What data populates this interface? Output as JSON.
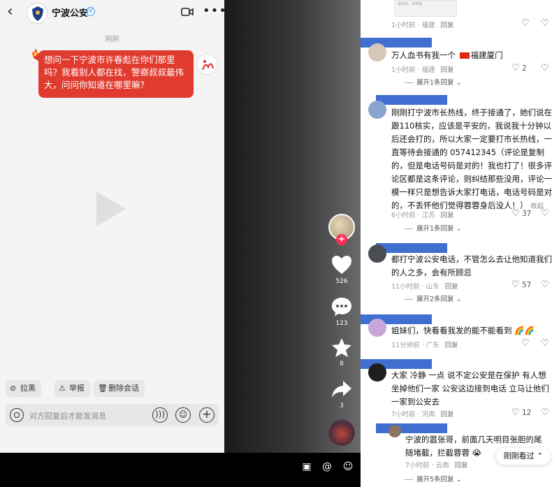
{
  "chat": {
    "contact_name": "宁波公安",
    "verified_badge": "V",
    "timestamp": "刚刚",
    "message": "想问一下宁波市许春彪在你们那里吗？我看别人都在找，警察叔叔最伟大，问问你知道在哪里嘛？",
    "actions": {
      "block": "拉黑",
      "report": "举报",
      "delete": "删除会话"
    },
    "input_placeholder": "对方回复后才能发消息",
    "icons": [
      "back-icon",
      "video-call-icon",
      "more-icon",
      "camera-icon",
      "voice-icon",
      "emoji-icon",
      "plus-icon"
    ]
  },
  "video_rail": {
    "likes": "526",
    "comments": "123",
    "favorites": "8",
    "shares": "3",
    "follow_plus": "+"
  },
  "bottom_bar": {
    "icons": [
      "image-icon",
      "mention-icon",
      "emoji-icon"
    ]
  },
  "comments": [
    {
      "meta_time": "1小时前",
      "meta_location": "福建",
      "reply": "回复",
      "thumb_text": "进去的，你找我"
    },
    {
      "text": "万人血书有我一个",
      "place": "福建厦门",
      "meta_time": "1小时前",
      "meta_location": "福建",
      "reply": "回复",
      "likes": "2",
      "expand": "展开1条回复"
    },
    {
      "text": "刚刚打宁波市长热线，终于接通了，她们说在跟110核实，应该是平安的，我说我十分钟以后还会打的，所以大家一定要打市长热线，一直等待会接通的 057412345（评论是复制的，但是电话号码是对的！我也打了！很多评论区都是这条评论，则纠结那些没用，评论一模一样只是想告诉大家打电话，电话号码是对的，不丢怀他们觉得蓉蓉身后没人！）",
      "collapse": "收起",
      "meta_time": "6小时前",
      "meta_location": "江苏",
      "reply": "回复",
      "likes": "37",
      "expand": "展开1条回复"
    },
    {
      "text": "都打宁波公安电话，不管怎么去让他知道我们的人之多，会有所顾忌",
      "meta_time": "11小时前",
      "meta_location": "山东",
      "reply": "回复",
      "likes": "57",
      "expand": "展开2条回复"
    },
    {
      "text": "姐妹们，快看看我发的能不能看到",
      "meta_time": "11分钟前",
      "meta_location": "广东",
      "reply": "回复"
    },
    {
      "text": "大家 冷静 一点 说不定公安是在保护 有人想坐掉他们一家 公安这边接到电话 立马让他们一家到公安去",
      "meta_time": "7小时前",
      "meta_location": "河南",
      "reply": "回复",
      "likes": "12"
    },
    {
      "text": "宁波的嚣张哥，前面几天明目张胆的尾随堵截，拦截蓉蓉",
      "meta_time": "7小时前",
      "meta_location": "云南",
      "reply": "回复",
      "expand": "展开5条回复"
    }
  ],
  "float_button": "刚刚看过 ⌃",
  "colors": {
    "bubble_red": "#e13a2e",
    "follow_pink": "#fe2c55",
    "redaction_blue": "#3f6fd1"
  }
}
